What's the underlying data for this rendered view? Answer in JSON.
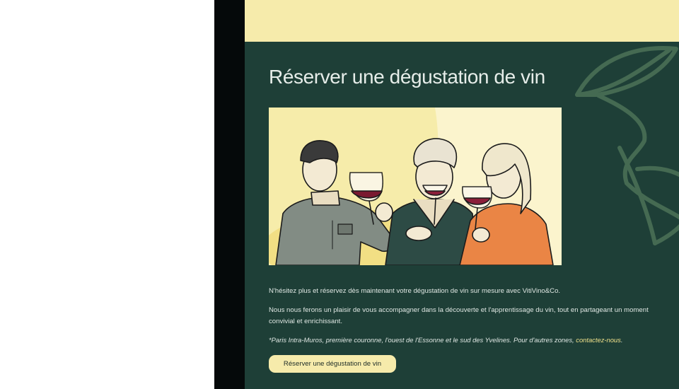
{
  "section": {
    "title": "Réserver une dégustation de vin",
    "illustration": "wine-tasting-illustration",
    "paragraph_1": "N'hésitez plus et réservez dès maintenant votre dégustation de vin sur mesure avec VitiVino&Co.",
    "paragraph_2": "Nous nous ferons un plaisir de vous accompagner dans la découverte et l'apprentissage du vin, tout en partageant un moment convivial et enrichissant.",
    "note_text": "*Paris Intra-Muros, première couronne, l'ouest de l'Essonne et le sud des Yvelines. Pour d'autres zones, ",
    "note_link": "contactez-nous",
    "note_end": ".",
    "cta_label": "Réserver une dégustation de vin"
  },
  "colors": {
    "band": "#f6ebab",
    "panel_green": "#1e3f37",
    "side_strip": "#05090a",
    "link": "#efe08a"
  }
}
